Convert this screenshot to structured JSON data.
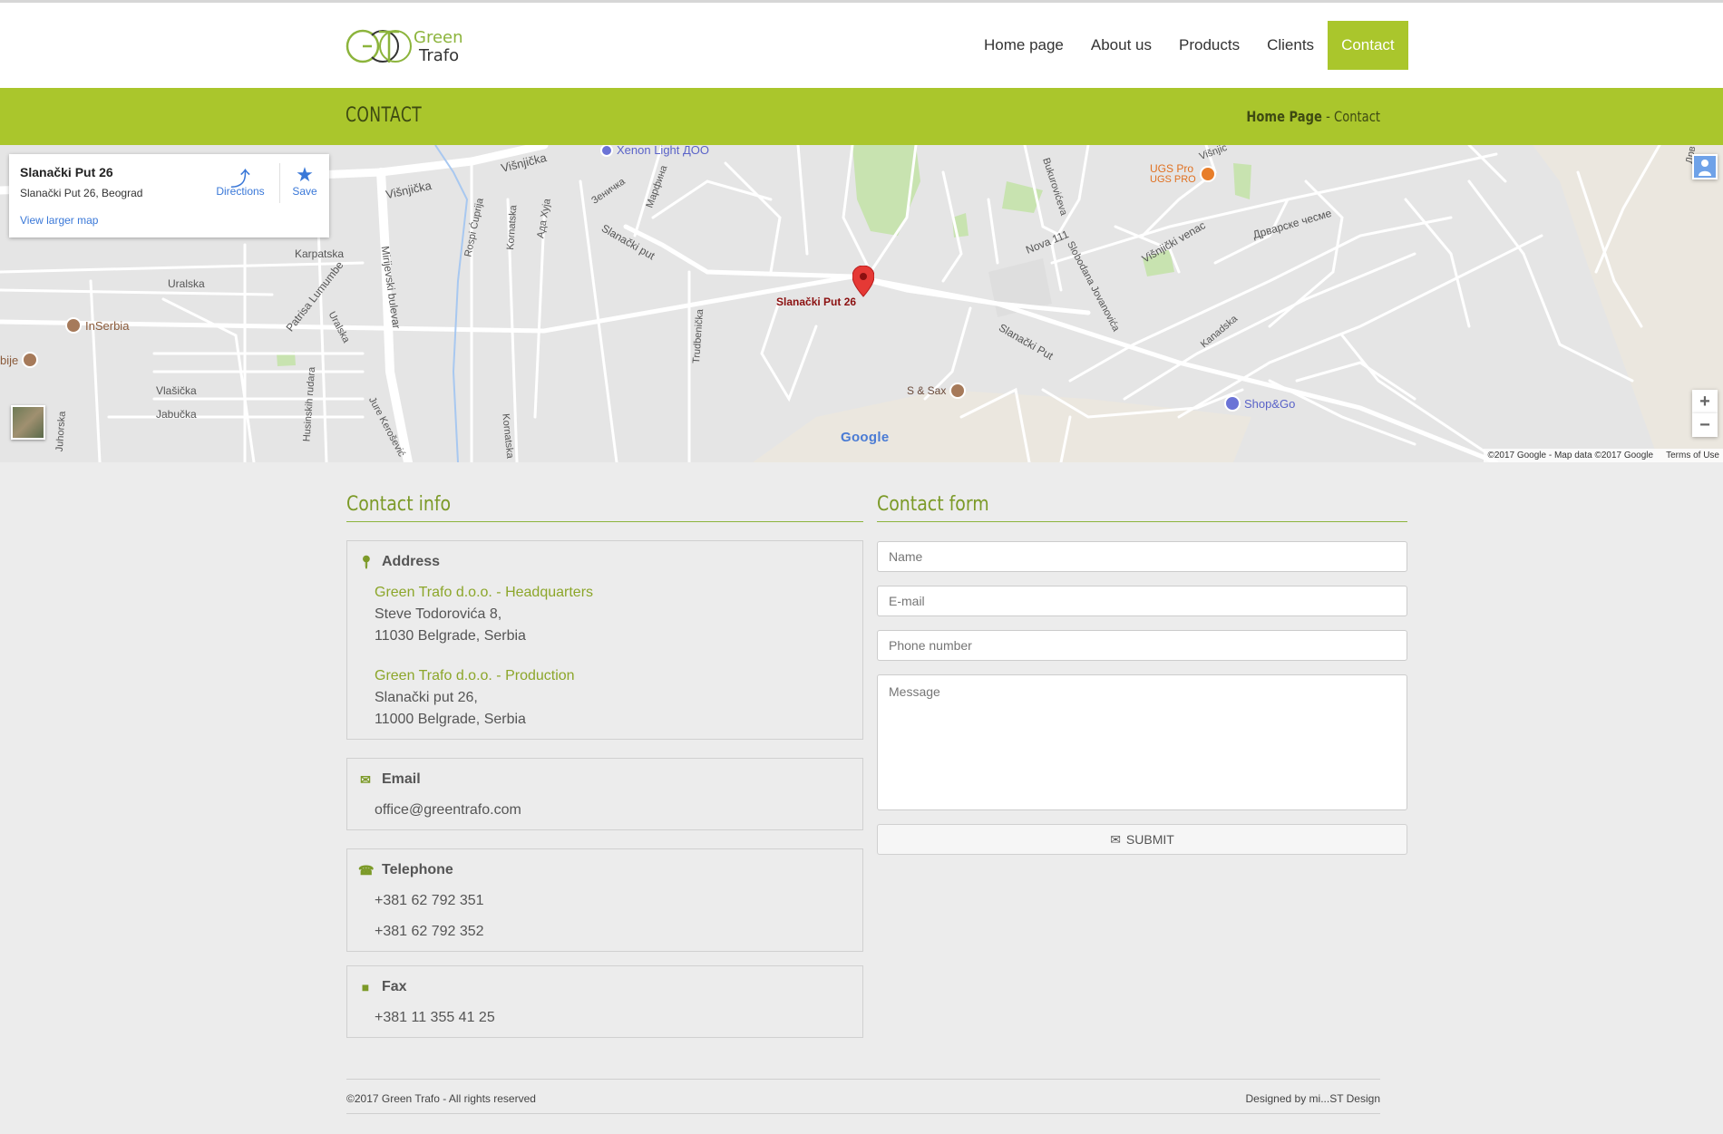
{
  "header": {
    "logo_green": "Green",
    "logo_trafo": "Trafo",
    "nav": [
      {
        "label": "Home page",
        "active": false
      },
      {
        "label": "About us",
        "active": false
      },
      {
        "label": "Products",
        "active": false
      },
      {
        "label": "Clients",
        "active": false
      },
      {
        "label": "Contact",
        "active": true
      }
    ]
  },
  "titlebar": {
    "title": "CONTACT",
    "breadcrumb_home": "Home Page",
    "breadcrumb_current": "Contact"
  },
  "map": {
    "infocard": {
      "title": "Slanački Put 26",
      "address": "Slanački Put 26, Beograd",
      "directions": "Directions",
      "save": "Save",
      "view_larger": "View larger map"
    },
    "pin_label": "Slanački Put 26",
    "street_labels": [
      "Višnjička",
      "Višnjička",
      "Karpatska",
      "Uralska",
      "Patrisa Lumumbe",
      "Mirijevski bulevar",
      "Rospi Ćuprija",
      "Kornatska",
      "Ада Хуја",
      "Зеничка",
      "Марфина",
      "Slanački put",
      "Trudbenička",
      "Nova 111",
      "Bukurovićeva",
      "Slobodana Jovanovića",
      "Višnjički venac",
      "Дрварске чесме",
      "Kanadska",
      "Slanački Put",
      "Vlašička",
      "Jabučka",
      "Husinskih rudara",
      "Jure Kerošević",
      "Uralska",
      "Juhorska",
      "Kornatska",
      "Višnjic",
      "Дрв"
    ],
    "pois": [
      {
        "label": "Xenon Light ДОО",
        "color": "#6b73d6"
      },
      {
        "label": "UGS Pro",
        "sub": "UGS PRO",
        "color": "#e87e2a"
      },
      {
        "label": "InSerbia",
        "color": "#a67a5a"
      },
      {
        "label": "S & Sax",
        "color": "#a67a5a"
      },
      {
        "label": "Shop&Go",
        "color": "#6b73d6"
      },
      {
        "label": "bije",
        "color": "#a67a5a"
      }
    ],
    "google": "Google",
    "copyright": "©2017 Google - Map data ©2017 Google",
    "terms": "Terms of Use",
    "zoom_in": "+",
    "zoom_out": "−"
  },
  "contact_info": {
    "title": "Contact info",
    "address": {
      "heading": "Address",
      "hq_name": "Green Trafo d.o.o. - Headquarters",
      "hq_line1": "Steve Todorovića 8,",
      "hq_line2": "11030 Belgrade, Serbia",
      "prod_name": "Green Trafo d.o.o. - Production",
      "prod_line1": "Slanački put 26,",
      "prod_line2": "11000 Belgrade, Serbia"
    },
    "email": {
      "heading": "Email",
      "value": "office@greentrafo.com"
    },
    "telephone": {
      "heading": "Telephone",
      "values": [
        "+381 62 792 351",
        "+381 62 792 352"
      ]
    },
    "fax": {
      "heading": "Fax",
      "value": "+381 11 355 41 25"
    }
  },
  "contact_form": {
    "title": "Contact form",
    "name_placeholder": "Name",
    "email_placeholder": "E-mail",
    "phone_placeholder": "Phone number",
    "message_placeholder": "Message",
    "submit": "SUBMIT"
  },
  "footer": {
    "copyright": "©2017 Green Trafo - All rights reserved",
    "designed_by": "Designed by mi...ST Design"
  },
  "colors": {
    "accent": "#aac62c",
    "section_green": "#7c9a28",
    "link_blue": "#3a78d8",
    "pin_red": "#e53935"
  }
}
